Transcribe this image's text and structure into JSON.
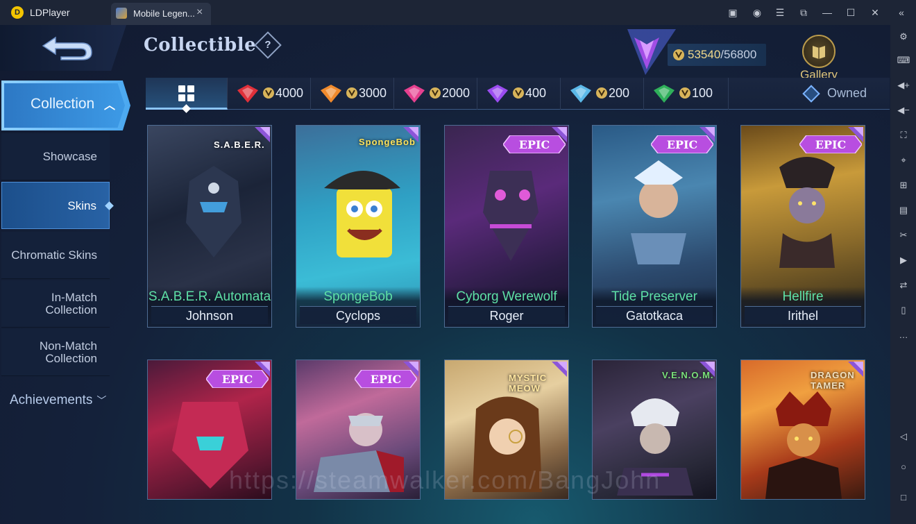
{
  "titlebar": {
    "app_name": "LDPlayer",
    "tab_label": "Mobile Legen...",
    "controls": [
      "store-icon",
      "account-icon",
      "menu-icon",
      "popout-icon",
      "minimize-icon",
      "maximize-icon",
      "close-icon",
      "collapse-sidebar-icon"
    ]
  },
  "right_toolbar": [
    "settings-icon",
    "keyboard-icon",
    "volume-up-icon",
    "volume-down-icon",
    "fullscreen-icon",
    "location-icon",
    "add-instance-icon",
    "apk-install-icon",
    "scissors-icon",
    "record-icon",
    "sync-icon",
    "multi-window-icon",
    "more-icon",
    "android-back-icon",
    "android-home-icon",
    "android-recents-icon"
  ],
  "header": {
    "title": "Collectible",
    "help": "?",
    "progress_current": "53540",
    "progress_total": "/56800",
    "gallery_label": "Gallery"
  },
  "nav": {
    "collection": "Collection",
    "items": [
      {
        "label": "Showcase",
        "active": false
      },
      {
        "label": "Skins",
        "active": true
      },
      {
        "label": "Chromatic Skins",
        "active": false
      },
      {
        "label": "In-Match Collection",
        "active": false
      },
      {
        "label": "Non-Match Collection",
        "active": false
      }
    ],
    "achievements": "Achievements"
  },
  "filters": {
    "prices": [
      {
        "value": "4000",
        "color": "#e0303a"
      },
      {
        "value": "3000",
        "color": "#f08a2c"
      },
      {
        "value": "2000",
        "color": "#e6408f"
      },
      {
        "value": "400",
        "color": "#9b4cf0"
      },
      {
        "value": "200",
        "color": "#5bb8e8"
      },
      {
        "value": "100",
        "color": "#2fb05a"
      }
    ],
    "owned_label": "Owned"
  },
  "cards_row1": [
    {
      "skin": "S.A.B.E.R. Automata",
      "hero": "Johnson",
      "logo": "S.A.B.E.R."
    },
    {
      "skin": "SpongeBob",
      "hero": "Cyclops",
      "logo": "SpongeBob"
    },
    {
      "skin": "Cyborg Werewolf",
      "hero": "Roger",
      "tier": "EPIC"
    },
    {
      "skin": "Tide Preserver",
      "hero": "Gatotkaca",
      "tier": "EPIC"
    },
    {
      "skin": "Hellfire",
      "hero": "Irithel",
      "tier": "EPIC"
    }
  ],
  "cards_row2": [
    {
      "tier": "EPIC"
    },
    {
      "tier": "EPIC"
    },
    {
      "logo": "MYSTIC MEOW"
    },
    {
      "logo": "V.E.N.O.M."
    },
    {
      "logo": "DRAGON TAMER"
    }
  ],
  "watermark": "https://steamwalker.com/BangJohn"
}
